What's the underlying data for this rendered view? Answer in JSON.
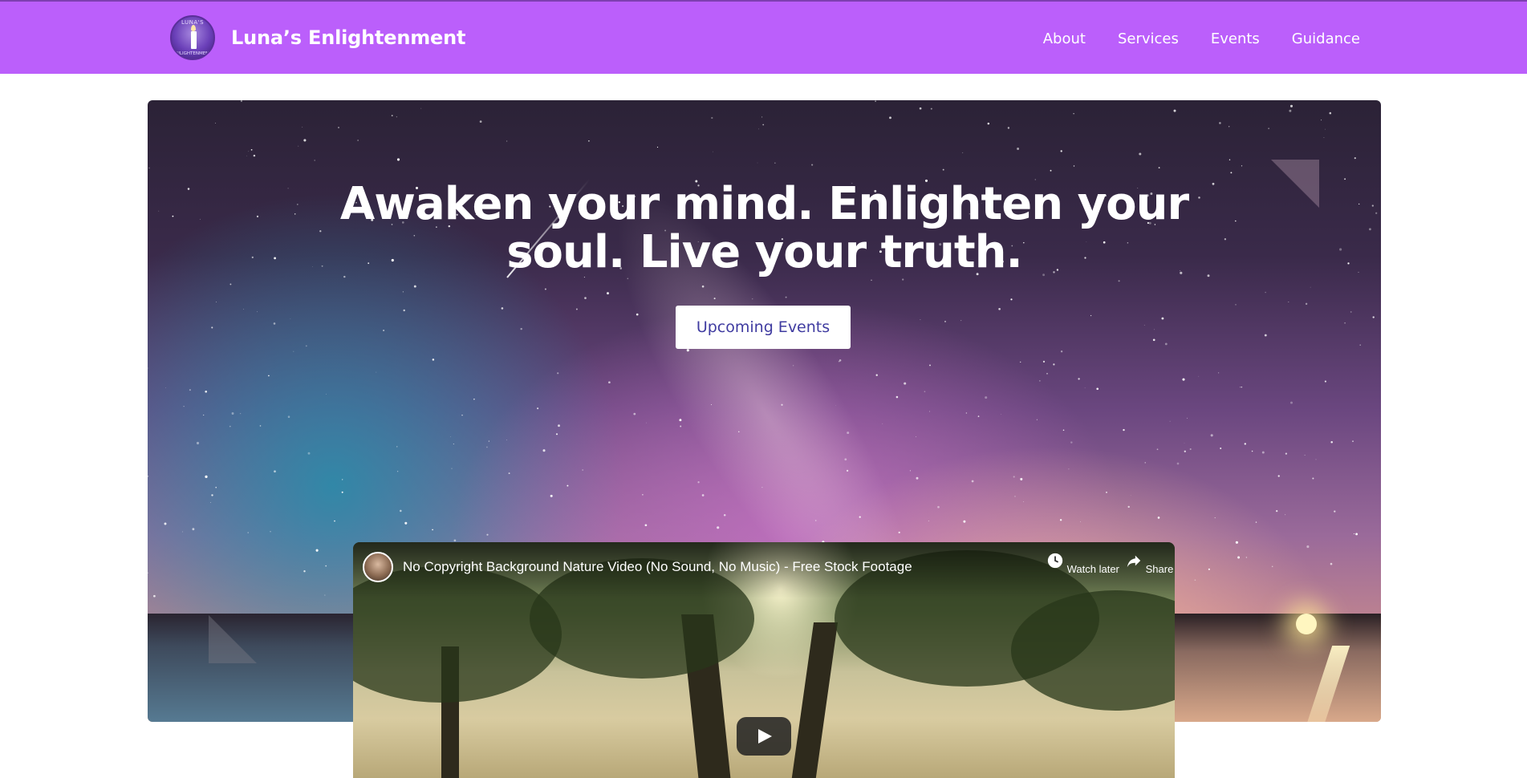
{
  "navbar": {
    "brand": "Luna’s Enlightenment",
    "logo_text_top": "LUNA'S",
    "logo_text_bottom": "ENLIGHTENMENT",
    "links": [
      "About",
      "Services",
      "Events",
      "Guidance"
    ],
    "background_color": "#bb5ffb"
  },
  "hero": {
    "title_line1": "Awaken your mind. Enlighten your",
    "title_line2": "soul. Live your truth.",
    "cta_label": "Upcoming Events",
    "cta_text_color": "#3f3ba0"
  },
  "video": {
    "title": "No Copyright Background Nature Video (No Sound, No Music) - Free Stock Footage",
    "watch_later": "Watch later",
    "share": "Share"
  }
}
